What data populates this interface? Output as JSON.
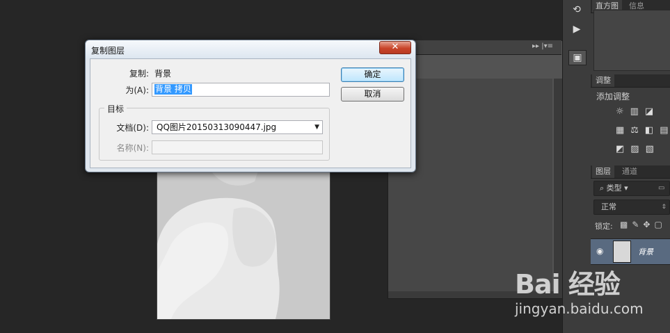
{
  "dialog": {
    "title": "复制图层",
    "close_glyph": "✕",
    "copy_label": "复制:",
    "copy_value": "背景",
    "as_label": "为(A):",
    "as_value": "背景 拷贝",
    "target_group": "目标",
    "document_label": "文档(D):",
    "document_value": "QQ图片20150313090447.jpg",
    "name_label": "名称(N):",
    "name_value": "",
    "ok": "确定",
    "cancel": "取消"
  },
  "panels": {
    "histogram_tab": "直方图",
    "info_tab": "信息",
    "adjustments_tab": "调整",
    "add_adjustment": "添加调整",
    "layers_tab": "图层",
    "channels_tab": "通道",
    "filter_kind": "类型",
    "blend_mode": "正常",
    "lock_label": "锁定:",
    "layer_name": "背景"
  },
  "watermark": {
    "brand": "Bai 经验",
    "url": "jingyan.baidu.com"
  },
  "icons": [
    "history-icon",
    "play-icon",
    "properties-icon",
    "close-icon",
    "eye-icon",
    "search-icon",
    "dropdown-arrow-icon"
  ]
}
